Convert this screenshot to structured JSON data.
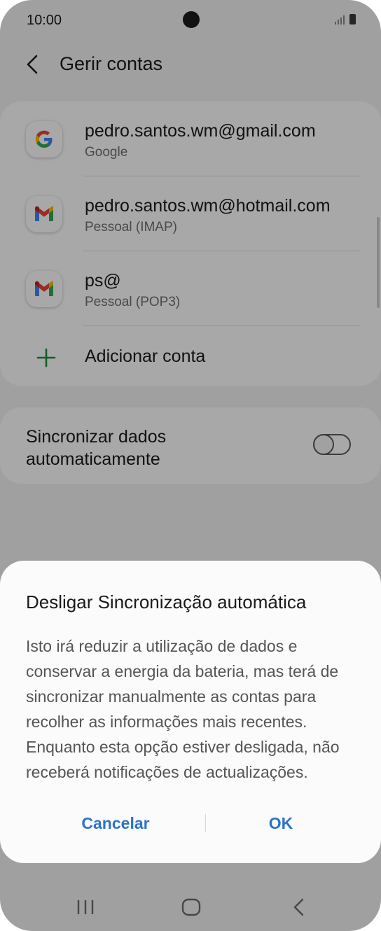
{
  "status_bar": {
    "time": "10:00"
  },
  "header": {
    "title": "Gerir contas"
  },
  "accounts": [
    {
      "email": "pedro.santos.wm@gmail.com",
      "type": "Google",
      "icon": "google-icon"
    },
    {
      "email": "pedro.santos.wm@hotmail.com",
      "type": "Pessoal (IMAP)",
      "icon": "gmail-icon"
    },
    {
      "email": "ps@",
      "type": "Pessoal (POP3)",
      "icon": "gmail-icon"
    }
  ],
  "add_account": {
    "label": "Adicionar conta",
    "icon": "plus-icon",
    "color": "#1a8f3c"
  },
  "sync": {
    "label": "Sincronizar dados automaticamente",
    "enabled": false
  },
  "dialog": {
    "title": "Desligar Sincronização automática",
    "body": "Isto irá reduzir a utilização de dados e conservar a energia da bateria, mas terá de sincronizar manualmente as contas para recolher as informações mais recentes. Enquanto esta opção estiver desligada, não receberá notificações de actualizações.",
    "cancel_label": "Cancelar",
    "ok_label": "OK",
    "button_color": "#2c73c9"
  },
  "nav_bar": {
    "icons": [
      "recent-apps-icon",
      "home-icon",
      "back-icon"
    ]
  }
}
